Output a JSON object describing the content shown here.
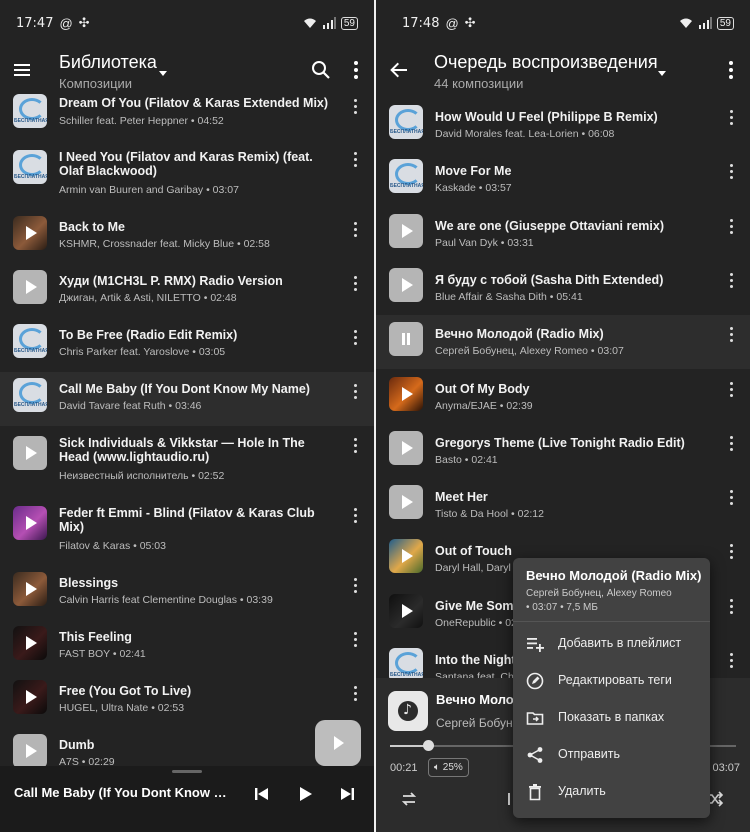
{
  "left": {
    "status": {
      "time": "17:47",
      "battery": "59"
    },
    "header": {
      "title": "Библиотека",
      "subtitle": "Композиции"
    },
    "tracks": [
      {
        "title": "Dream Of You (Filatov & Karas Extended Mix)",
        "meta": "Schiller feat. Peter Heppner • 04:52",
        "thumb": "logo"
      },
      {
        "title": "I Need You (Filatov and Karas Remix) (feat. Olaf Blackwood)",
        "meta": "Armin van Buuren and Garibay • 03:07",
        "thumb": "logo"
      },
      {
        "title": "Back to Me",
        "meta": "KSHMR, Crossnader feat. Micky Blue • 02:58",
        "thumb": "photo"
      },
      {
        "title": "Худи (M1CH3L P. RMX) Radio Version",
        "meta": "Джиган, Artik & Asti, NILETTO • 02:48",
        "thumb": "grey"
      },
      {
        "title": "To Be Free (Radio Edit Remix)",
        "meta": "Chris Parker feat. Yaroslove • 03:05",
        "thumb": "logo"
      },
      {
        "title": "Call Me Baby (If You Dont Know My Name)",
        "meta": "David Tavare feat Ruth • 03:46",
        "thumb": "logo"
      },
      {
        "title": "Sick Individuals & Vikkstar — Hole In The Head (www.lightaudio.ru)",
        "meta": "Неизвестный исполнитель • 02:52",
        "thumb": "grey"
      },
      {
        "title": "Feder ft Emmi - Blind (Filatov & Karas Club Mix)",
        "meta": "Filatov & Karas • 05:03",
        "thumb": "purple"
      },
      {
        "title": "Blessings",
        "meta": "Calvin Harris feat Clementine Douglas • 03:39",
        "thumb": "photo"
      },
      {
        "title": "This Feeling",
        "meta": "FAST BOY • 02:41",
        "thumb": "dark"
      },
      {
        "title": "Free (You Got To Live)",
        "meta": "HUGEL, Ultra Nate • 02:53",
        "thumb": "dark"
      },
      {
        "title": "Dumb",
        "meta": "A7S • 02:29",
        "thumb": "grey"
      }
    ],
    "mini_player": {
      "title": "Call Me Baby (If You Dont Know My Name)"
    }
  },
  "right": {
    "status": {
      "time": "17:48",
      "battery": "59"
    },
    "header": {
      "title": "Очередь воспроизведения",
      "subtitle": "44 композиции"
    },
    "tracks": [
      {
        "title": "How Would U Feel (Philippe B Remix)",
        "meta": "David Morales feat. Lea-Lorien • 06:08",
        "thumb": "logo"
      },
      {
        "title": "Move For Me",
        "meta": "Kaskade • 03:57",
        "thumb": "logo"
      },
      {
        "title": "We are one (Giuseppe Ottaviani remix)",
        "meta": "Paul Van Dyk • 03:31",
        "thumb": "grey"
      },
      {
        "title": "Я буду с тобой (Sasha Dith Extended)",
        "meta": "Blue Affair & Sasha Dith • 05:41",
        "thumb": "grey"
      },
      {
        "title": "Вечно Молодой (Radio Mix)",
        "meta": "Сергей Бобунец, Alexey Romeo • 03:07",
        "thumb": "pause"
      },
      {
        "title": "Out Of My Body",
        "meta": "Anyma/EJAE • 02:39",
        "thumb": "orange"
      },
      {
        "title": "Gregorys Theme (Live Tonight Radio Edit)",
        "meta": "Basto • 02:41",
        "thumb": "grey"
      },
      {
        "title": "Meet Her",
        "meta": "Tisto & Da Hool • 02:12",
        "thumb": "grey"
      },
      {
        "title": "Out of Touch",
        "meta": "Daryl Hall, Daryl",
        "thumb": "sky"
      },
      {
        "title": "Give Me Some",
        "meta": "OneRepublic • 02",
        "thumb": "black"
      },
      {
        "title": "Into the Night",
        "meta": "Santana feat. Ch",
        "thumb": "logo"
      }
    ],
    "now_playing": {
      "title": "Вечно Молодой (Radio Mix)",
      "artist": "Сергей Бобунец, Alexey Romeo",
      "elapsed": "00:21",
      "total": "03:07",
      "progress": 0.11,
      "volume_label": "25%"
    },
    "context_menu": {
      "title": "Вечно Молодой (Radio Mix)",
      "artist": "Сергей Бобунец, Alexey Romeo",
      "info": "• 03:07 • 7,5 МБ",
      "items": [
        {
          "label": "Добавить в плейлист",
          "icon": "playlist-add-icon"
        },
        {
          "label": "Редактировать теги",
          "icon": "edit-tags-icon"
        },
        {
          "label": "Показать в папках",
          "icon": "folder-icon"
        },
        {
          "label": "Отправить",
          "icon": "share-icon"
        },
        {
          "label": "Удалить",
          "icon": "trash-icon"
        }
      ]
    }
  }
}
